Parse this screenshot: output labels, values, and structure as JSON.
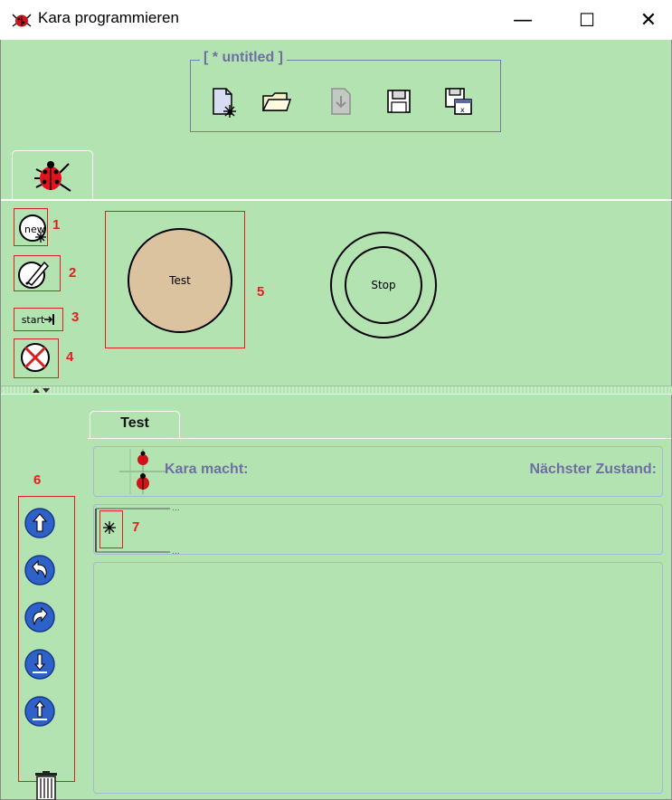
{
  "window": {
    "title": "Kara programmieren",
    "minimize": "—",
    "maximize": "☐",
    "close": "✕"
  },
  "file_toolbar": {
    "title": "[ * untitled ]",
    "buttons": [
      "new-file-icon",
      "open-folder-icon",
      "import-icon",
      "save-icon",
      "save-as-icon"
    ]
  },
  "state_tools": {
    "numbers": [
      "1",
      "2",
      "3",
      "4",
      "5"
    ],
    "start_label": "start"
  },
  "states": {
    "test": "Test",
    "stop": "Stop"
  },
  "rules_tab": {
    "label": "Test",
    "kara_macht": "Kara macht:",
    "naechster_zustand": "Nächster Zustand:"
  },
  "command_panel": {
    "number": "6",
    "rule_number": "7",
    "commands": [
      "move-forward-icon",
      "turn-left-icon",
      "turn-right-icon",
      "put-leaf-icon",
      "remove-leaf-icon"
    ]
  },
  "colors": {
    "panel_bg": "#b4e3b2",
    "accent_text": "#6f6fa6",
    "annotation": "#e02020",
    "test_state_fill": "#dcc3a0"
  }
}
